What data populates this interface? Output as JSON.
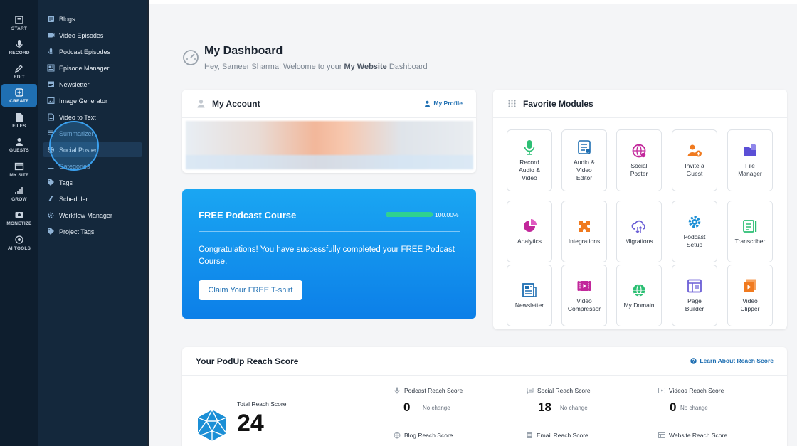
{
  "rail": {
    "items": [
      {
        "label": "START",
        "icon": "start-icon"
      },
      {
        "label": "RECORD",
        "icon": "mic-icon"
      },
      {
        "label": "EDIT",
        "icon": "edit-icon"
      },
      {
        "label": "CREATE",
        "icon": "create-icon",
        "active": true
      },
      {
        "label": "FILES",
        "icon": "files-icon"
      },
      {
        "label": "GUESTS",
        "icon": "guests-icon"
      },
      {
        "label": "MY SITE",
        "icon": "site-icon"
      },
      {
        "label": "GROW",
        "icon": "grow-icon"
      },
      {
        "label": "MONETIZE",
        "icon": "monetize-icon"
      },
      {
        "label": "AI TOOLS",
        "icon": "ai-icon"
      }
    ]
  },
  "submenu": {
    "items": [
      {
        "label": "Blogs"
      },
      {
        "label": "Video Episodes"
      },
      {
        "label": "Podcast Episodes"
      },
      {
        "label": "Episode Manager"
      },
      {
        "label": "Newsletter"
      },
      {
        "label": "Image Generator"
      },
      {
        "label": "Video to Text"
      },
      {
        "label": "Summarizer"
      },
      {
        "label": "Social Poster"
      },
      {
        "label": "Categories"
      },
      {
        "label": "Tags"
      },
      {
        "label": "Scheduler"
      },
      {
        "label": "Workflow Manager"
      },
      {
        "label": "Project Tags"
      }
    ]
  },
  "header": {
    "title": "My Dashboard",
    "greeting_prefix": "Hey, Sameer Sharma! Welcome to your ",
    "site_name": "My Website",
    "greeting_suffix": " Dashboard"
  },
  "account": {
    "title": "My Account",
    "profile_link": "My Profile"
  },
  "course": {
    "title": "FREE Podcast Course",
    "progress": 100,
    "progress_label": "100.00%",
    "message": "Congratulations! You have successfully completed your FREE Podcast Course.",
    "button": "Claim Your FREE T-shirt"
  },
  "modules": {
    "title": "Favorite Modules",
    "items": [
      {
        "label": "Record\nAudio &\nVideo",
        "icon": "mic-icon",
        "color": "#2dbf74"
      },
      {
        "label": "Audio &\nVideo\nEditor",
        "icon": "editor-icon",
        "color": "#1f6fb2"
      },
      {
        "label": "Social\nPoster",
        "icon": "social-icon",
        "color": "#c2279b"
      },
      {
        "label": "Invite a\nGuest",
        "icon": "invite-icon",
        "color": "#f07a1f"
      },
      {
        "label": "File\nManager",
        "icon": "folder-icon",
        "color": "#5b4fd6"
      },
      {
        "label": "Analytics",
        "icon": "pie-icon",
        "color": "#c2279b"
      },
      {
        "label": "Integrations",
        "icon": "puzzle-icon",
        "color": "#f07a1f"
      },
      {
        "label": "Migrations",
        "icon": "cloud-icon",
        "color": "#6b5fd6"
      },
      {
        "label": "Podcast\nSetup",
        "icon": "gear-icon",
        "color": "#1b8fd6"
      },
      {
        "label": "Transcriber",
        "icon": "transcribe-icon",
        "color": "#2dbf74"
      },
      {
        "label": "Newsletter",
        "icon": "newsletter-icon",
        "color": "#1f6fb2"
      },
      {
        "label": "Video\nCompressor",
        "icon": "compress-icon",
        "color": "#c2279b"
      },
      {
        "label": "My Domain",
        "icon": "globe-icon",
        "color": "#2dbf74"
      },
      {
        "label": "Page\nBuilder",
        "icon": "builder-icon",
        "color": "#6b5fd6"
      },
      {
        "label": "Video\nClipper",
        "icon": "clipper-icon",
        "color": "#f07a1f"
      }
    ]
  },
  "reach": {
    "title": "Your PodUp Reach Score",
    "learn_link": "Learn About Reach Score",
    "total_label": "Total Reach Score",
    "total_value": "24",
    "metrics": [
      {
        "label": "Podcast Reach Score",
        "value": "0",
        "change": "No change"
      },
      {
        "label": "Social Reach Score",
        "value": "18",
        "change": "No change"
      },
      {
        "label": "Videos Reach Score",
        "value": "0",
        "change": "No change"
      },
      {
        "label": "Blog Reach Score"
      },
      {
        "label": "Email Reach Score"
      },
      {
        "label": "Website Reach Score"
      }
    ]
  }
}
